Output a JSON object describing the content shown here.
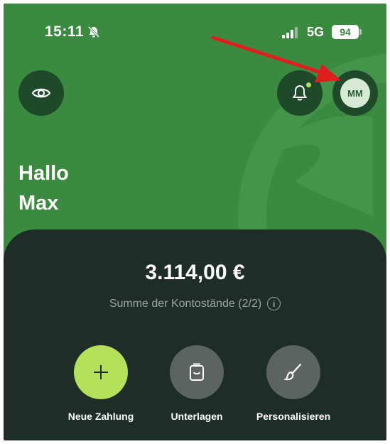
{
  "status_bar": {
    "time": "15:11",
    "network": "5G",
    "battery": "94",
    "icons": [
      "bell-slash-icon",
      "signal-icon"
    ]
  },
  "header": {
    "eye_icon": "eye-icon",
    "notification_icon": "bell-icon",
    "avatar_initials": "MM"
  },
  "greeting": {
    "line1": "Hallo",
    "line2": "Max"
  },
  "account": {
    "balance": "3.114,00 €",
    "summary_label": "Summe der Kontostände (2/2)",
    "info_icon": "i"
  },
  "actions": [
    {
      "label": "Neue Zahlung",
      "icon": "plus-icon"
    },
    {
      "label": "Unterlagen",
      "icon": "inbox-icon"
    },
    {
      "label": "Personalisieren",
      "icon": "paintbrush-icon"
    }
  ],
  "colors": {
    "header_green": "#3a8a3f",
    "card_dark": "#1e2d28",
    "accent_lime": "#b4e05a",
    "annotation_red": "#e01e1e"
  }
}
